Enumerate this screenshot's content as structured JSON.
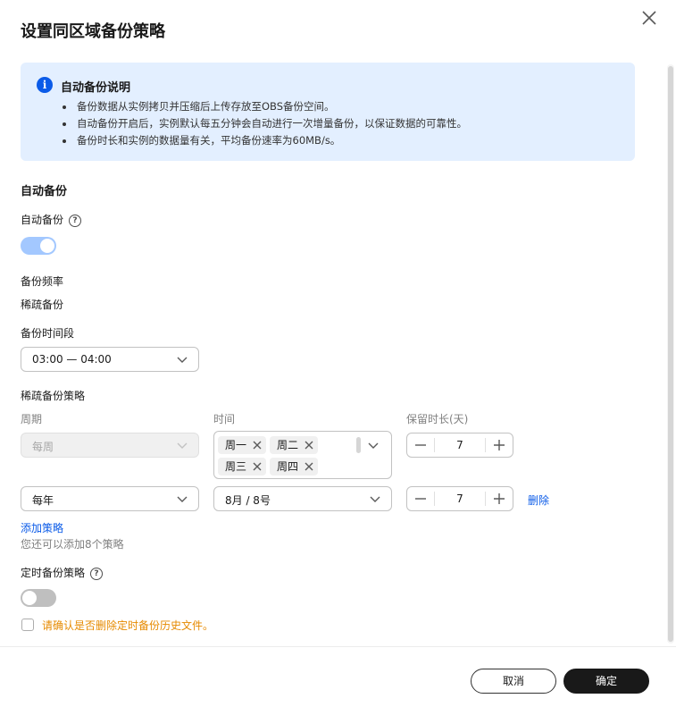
{
  "dialog": {
    "title": "设置同区域备份策略",
    "cancel_label": "取消",
    "confirm_label": "确定"
  },
  "info": {
    "title": "自动备份说明",
    "items": [
      "备份数据从实例拷贝并压缩后上传存放至OBS备份空间。",
      "自动备份开启后，实例默认每五分钟会自动进行一次增量备份，以保证数据的可靠性。",
      "备份时长和实例的数据量有关，平均备份速率为60MB/s。"
    ]
  },
  "auto_backup": {
    "section_title": "自动备份",
    "toggle_label": "自动备份",
    "toggle_on": true,
    "frequency_label": "备份频率",
    "frequency_value": "稀疏备份",
    "period_label": "备份时间段",
    "period_value": "03:00 — 04:00"
  },
  "sparse_policy": {
    "title": "稀疏备份策略",
    "col_cycle": "周期",
    "col_time": "时间",
    "col_retention": "保留时长(天)",
    "rows": [
      {
        "cycle": "每周",
        "tags": [
          "周一",
          "周二",
          "周三",
          "周四"
        ],
        "retention": "7"
      },
      {
        "cycle": "每年",
        "time": "8月 / 8号",
        "retention": "7",
        "delete_label": "删除"
      }
    ],
    "add_label": "添加策略",
    "hint": "您还可以添加8个策略"
  },
  "scheduled": {
    "label": "定时备份策略",
    "toggle_on": false,
    "confirm_text": "请确认是否删除定时备份历史文件。"
  },
  "colors": {
    "accent": "#0b5be8",
    "info_bg": "#e3efff",
    "toggle_on": "#a3c8ff",
    "warning": "#e68a00",
    "primary_button": "#191919"
  }
}
